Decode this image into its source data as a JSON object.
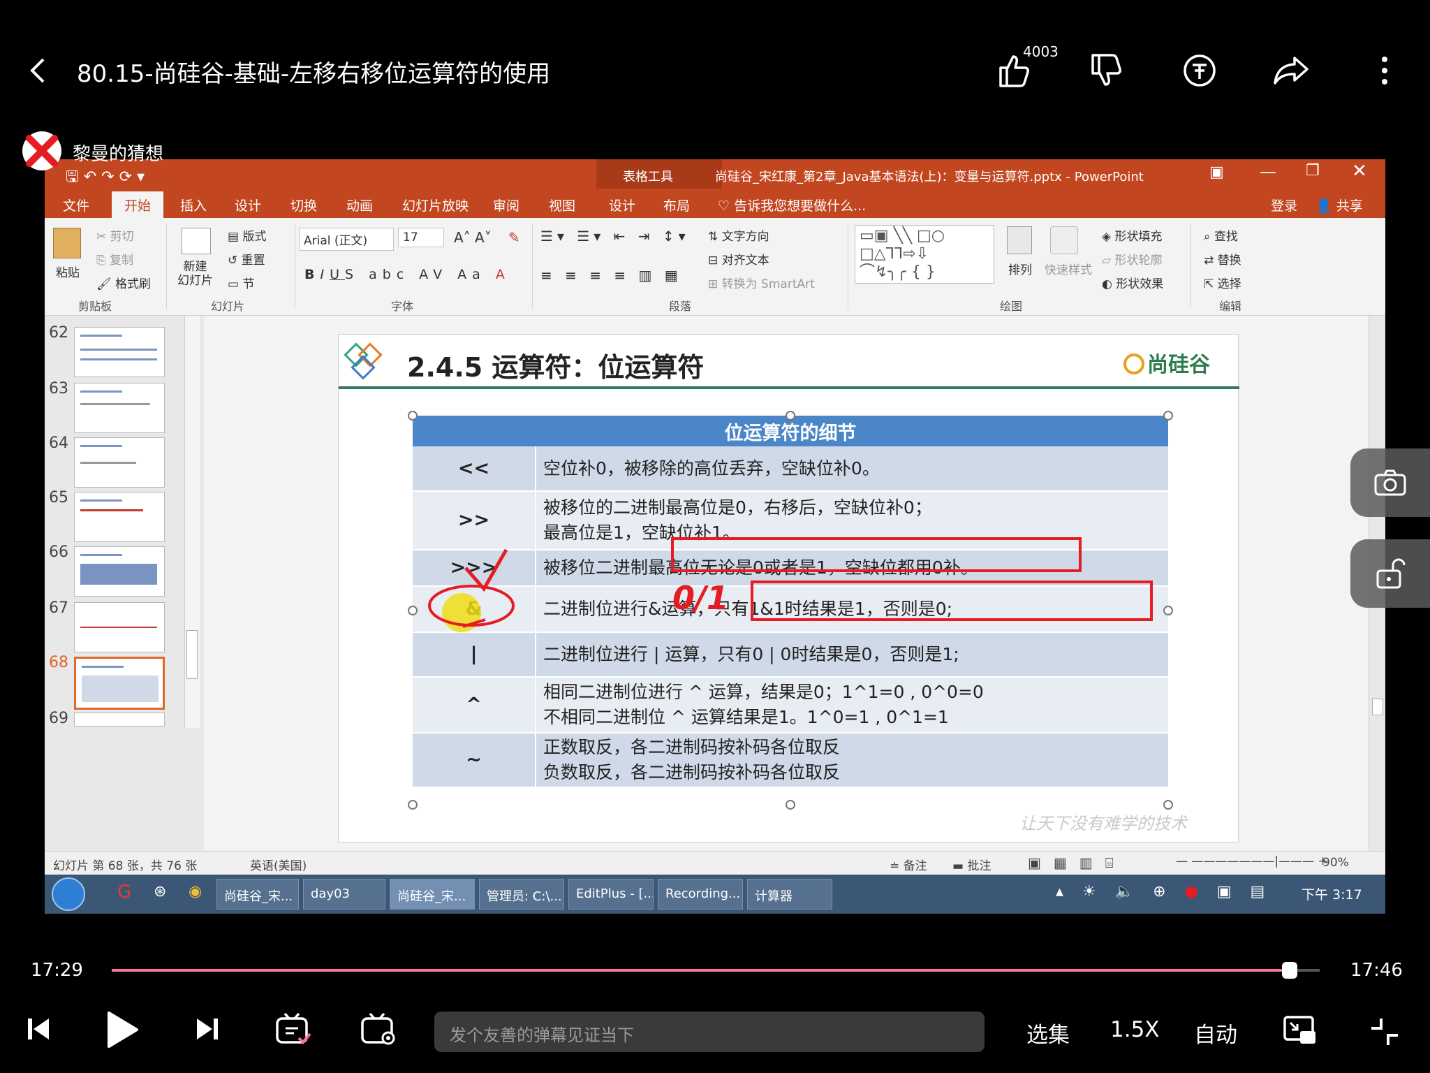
{
  "top": {
    "back_icon": "chevron-left-icon",
    "title": "80.15-尚硅谷-基础-左移右移位运算符的使用",
    "like_count": "4003"
  },
  "uploader": {
    "name": "黎曼的猜想"
  },
  "ppt": {
    "context_tool": "表格工具",
    "window_title": "尚硅谷_宋红康_第2章_Java基本语法(上)：变量与运算符.pptx - PowerPoint",
    "tabs": [
      "文件",
      "开始",
      "插入",
      "设计",
      "切换",
      "动画",
      "幻灯片放映",
      "审阅",
      "视图",
      "设计",
      "布局"
    ],
    "tell_me": "告诉我您想要做什么...",
    "login": "登录",
    "share": "共享",
    "ribbon": {
      "paste": "粘贴",
      "cut": "剪切",
      "copy": "复制",
      "format_painter": "格式刷",
      "clipboard": "剪贴板",
      "new_slide": "新建\n幻灯片",
      "layout": "版式",
      "reset": "重置",
      "section": "节",
      "slides": "幻灯片",
      "font_name": "Arial (正文)",
      "font_size": "17",
      "font": "字体",
      "paragraph": "段落",
      "text_direction": "文字方向",
      "align_text": "对齐文本",
      "smartart": "转换为 SmartArt",
      "arrange": "排列",
      "quick_styles": "快速样式",
      "shape_fill": "形状填充",
      "shape_outline": "形状轮廓",
      "shape_effects": "形状效果",
      "drawing": "绘图",
      "find": "查找",
      "replace": "替换",
      "select": "选择",
      "editing": "编辑"
    },
    "thumbnails": [
      "62",
      "63",
      "64",
      "65",
      "66",
      "67",
      "68",
      "69"
    ],
    "selected_thumb": "68",
    "slide": {
      "heading": "2.4.5  运算符：位运算符",
      "brand": "尚硅谷",
      "table_title": "位运算符的细节",
      "rows": [
        {
          "op": "<<",
          "desc": [
            "空位补0，被移除的高位丢弃，空缺位补0。"
          ]
        },
        {
          "op": ">>",
          "desc": [
            "被移位的二进制最高位是0，右移后，空缺位补0；",
            "最高位是1，空缺位补1。"
          ]
        },
        {
          "op": ">>>",
          "desc": [
            "被移位二进制最高位无论是0或者是1，空缺位都用0补。"
          ]
        },
        {
          "op": "&",
          "desc": [
            "二进制位进行&运算，只有1&1时结果是1，否则是0;"
          ]
        },
        {
          "op": "|",
          "desc": [
            "二进制位进行 | 运算，只有0 | 0时结果是0，否则是1;"
          ]
        },
        {
          "op": "^",
          "desc": [
            "相同二进制位进行 ^ 运算，结果是0；1^1=0 , 0^0=0",
            "不相同二进制位 ^ 运算结果是1。1^0=1 , 0^1=1"
          ]
        },
        {
          "op": "~",
          "desc": [
            "正数取反，各二进制码按补码各位取反",
            "负数取反，各二进制码按补码各位取反"
          ]
        }
      ],
      "watermark": "让天下没有难学的技术",
      "annotation": "0/1"
    },
    "status": {
      "slide_info": "幻灯片 第 68 张，共 76 张",
      "language": "英语(美国)",
      "notes": "备注",
      "comments": "批注",
      "zoom": "90%"
    },
    "taskbar": {
      "items": [
        "尚硅谷_宋...",
        "day03",
        "尚硅谷_宋...",
        "管理员: C:\\...",
        "EditPlus - [...",
        "Recording...",
        "计算器"
      ],
      "clock": "下午 3:17"
    }
  },
  "player": {
    "current_time": "17:29",
    "total_time": "17:46",
    "progress": 0.97,
    "danmaku_placeholder": "发个友善的弹幕见证当下",
    "episodes": "选集",
    "speed": "1.5X",
    "quality": "自动",
    "accent_color": "#fb7299"
  }
}
